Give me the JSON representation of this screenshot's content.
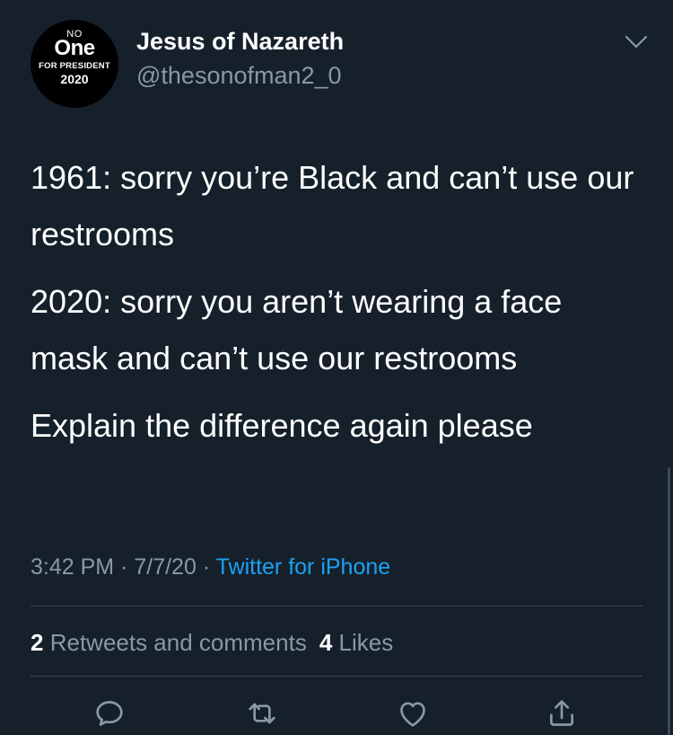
{
  "avatar": {
    "line1": "NO",
    "line2": "One",
    "line3": "FOR PRESIDENT",
    "line4": "2020"
  },
  "author": {
    "display_name": "Jesus of Nazareth",
    "handle": "@thesonofman2_0"
  },
  "tweet": {
    "paragraphs": [
      "1961: sorry you’re Black and can’t use our restrooms",
      "2020: sorry you aren’t wearing a face mask and can’t use our restrooms",
      "Explain the difference again please"
    ]
  },
  "meta": {
    "time": "3:42 PM",
    "separator": "·",
    "date": "7/7/20",
    "source": "Twitter for iPhone"
  },
  "stats": {
    "retweets_count": "2",
    "retweets_label": "Retweets and comments",
    "likes_count": "4",
    "likes_label": "Likes"
  },
  "icons": {
    "menu": "chevron-down-icon",
    "reply": "reply-icon",
    "retweet": "retweet-icon",
    "like": "heart-icon",
    "share": "share-icon"
  },
  "colors": {
    "background": "#15202b",
    "text": "#ffffff",
    "secondary_text": "#8899a6",
    "link": "#1da1f2",
    "divider": "#38444d"
  }
}
